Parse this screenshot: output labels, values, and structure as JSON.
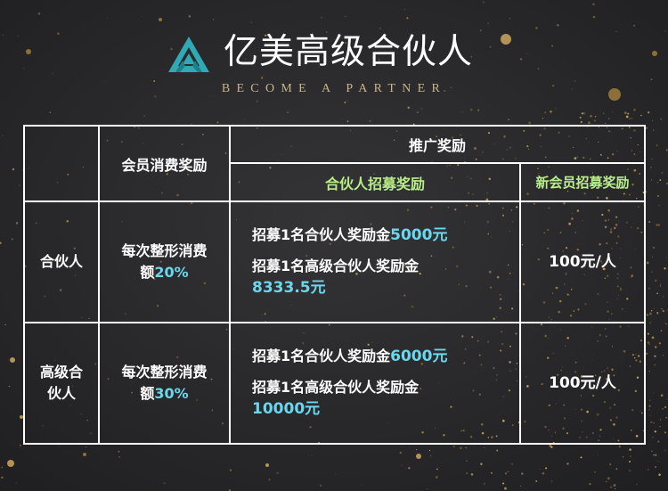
{
  "header": {
    "title": "亿美高级合伙人",
    "subtitle": "BECOME A PARTNER"
  },
  "table": {
    "col_member_reward": "会员消费奖励",
    "col_promo_reward": "推广奖励",
    "col_partner_recruit": "合伙人招募奖励",
    "col_new_member": "新会员招募奖励",
    "rows": [
      {
        "label": "合伙人",
        "reward_text": "每次整形消费额",
        "reward_pct": "20%",
        "line1_text": "招募1名合伙人奖励金",
        "line1_amount": "5000元",
        "line2_text": "招募1名高级合伙人奖励金",
        "line2_amount": "8333.5元",
        "new_member": "100元/人"
      },
      {
        "label": "高级合伙人",
        "reward_text": "每次整形消费额",
        "reward_pct": "30%",
        "line1_text": "招募1名合伙人奖励金",
        "line1_amount": "6000元",
        "line2_text": "招募1名高级合伙人奖励金",
        "line2_amount": "10000元",
        "new_member": "100元/人"
      }
    ]
  },
  "colors": {
    "background": "#2b2b2d",
    "grid": "#ffffff",
    "accent_green": "#b7ee8a",
    "accent_cyan": "#69d8ee",
    "gold": "#c8a25a",
    "logo_teal": "#2fa9b5"
  }
}
